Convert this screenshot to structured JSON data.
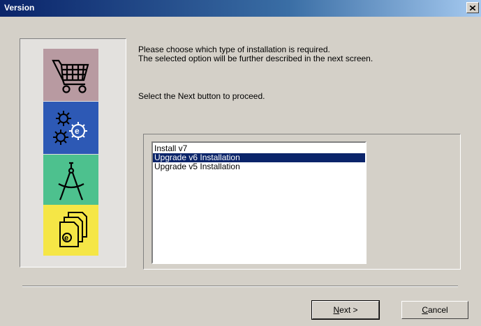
{
  "window": {
    "title": "Version"
  },
  "icons": [
    "shopping-cart-icon",
    "gears-icon",
    "drafting-compass-icon",
    "documents-icon"
  ],
  "colors": {
    "title_bar": "#0a246a",
    "selection": "#0a246a",
    "tile_pink": "#b89aa1",
    "tile_blue": "#2d59b5",
    "tile_green": "#4dc18e",
    "tile_yellow": "#f5e646"
  },
  "instructions": {
    "line1": "Please choose which type of installation is required.",
    "line2": "The selected option will be further described in the next screen.",
    "line3": "Select the Next button to proceed."
  },
  "options": {
    "items": [
      "Install v7",
      "Upgrade v6 Installation",
      "Upgrade v5 Installation"
    ],
    "selected": "Upgrade v6 Installation"
  },
  "buttons": {
    "next_mnemonic": "N",
    "next_rest": "ext >",
    "cancel_mnemonic": "C",
    "cancel_rest": "ancel"
  }
}
